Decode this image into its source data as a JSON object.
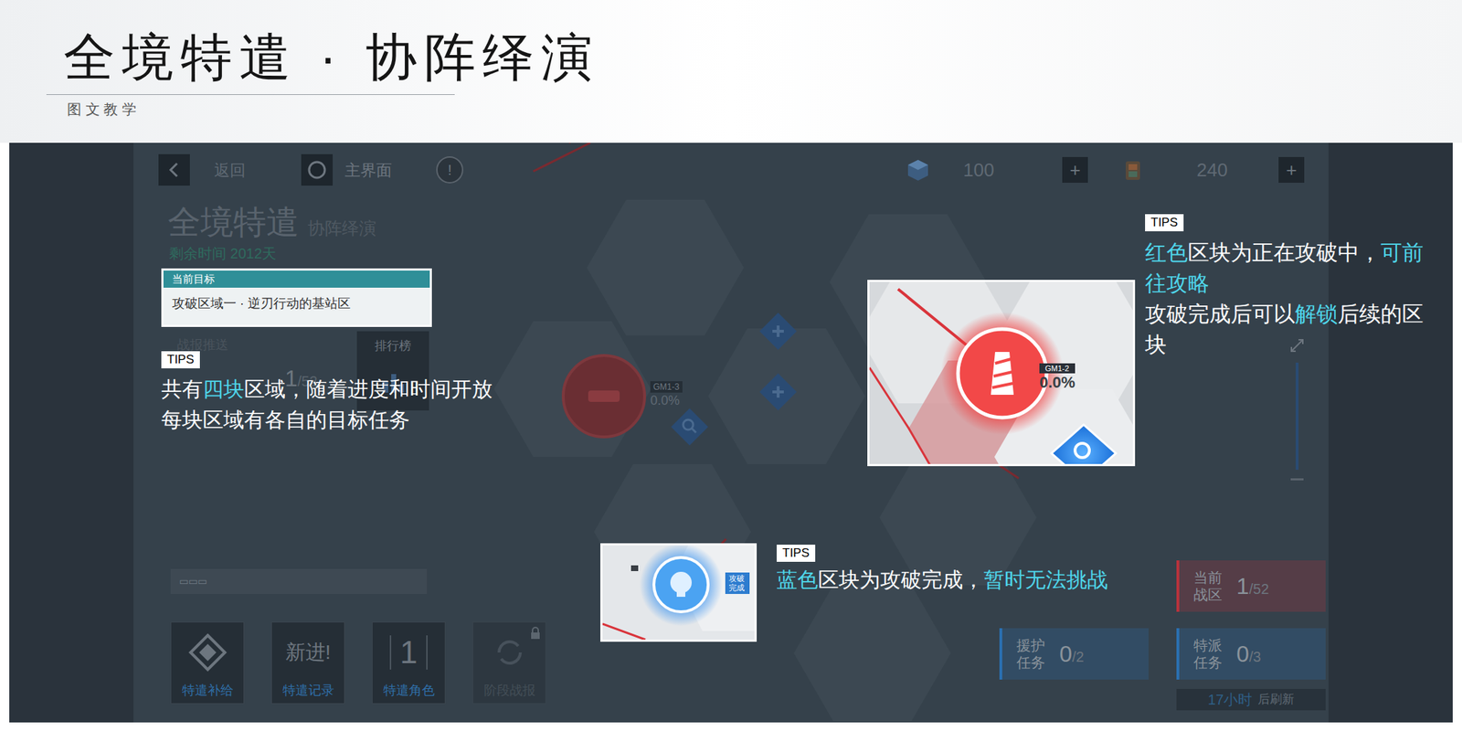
{
  "header": {
    "title": "全境特遣 · 协阵绎演",
    "subtitle": "图 文 教 学"
  },
  "game": {
    "top_bar": {
      "back": "返回",
      "home": "主界面",
      "alert": "!",
      "currencies": [
        {
          "value": "100",
          "plus": "+"
        },
        {
          "value": "240",
          "plus": "+"
        }
      ]
    },
    "title": "全境特遣",
    "subtitle": "协阵绎演",
    "time_left": "剩余时间 2012天",
    "target": {
      "header": "当前目标",
      "text": "攻破区域一 · 逆刃行动的基站区"
    },
    "news": "战报推送",
    "progress": {
      "value": "1",
      "total": "/52"
    },
    "ranking": "排行榜",
    "search_hint": "▭▭▭",
    "map_node": {
      "code": "GM1-3",
      "reading": "0.0%"
    },
    "bottom_buttons": [
      {
        "label": "特遣补给",
        "kind": "icon",
        "disabled": false
      },
      {
        "label": "特遣记录",
        "kind": "badge",
        "badge": "新进!",
        "disabled": false
      },
      {
        "label": "特遣角色",
        "kind": "count",
        "count": "1",
        "disabled": false
      },
      {
        "label": "阶段战报",
        "kind": "locked",
        "disabled": true
      }
    ],
    "panels": [
      {
        "label": "当前战区",
        "value": "1",
        "total": "/52",
        "color": "#b8323c"
      },
      {
        "label": "援护任务",
        "value": "0",
        "total": "/2",
        "color": "#2a6fb0"
      },
      {
        "label": "特派任务",
        "value": "0",
        "total": "/3",
        "color": "#2a6fb0"
      }
    ],
    "refresh": {
      "time": "17小时",
      "suffix": "后刷新"
    }
  },
  "tips": [
    {
      "label": "TIPS",
      "lines": [
        [
          {
            "text": "共有",
            "highlight": false
          },
          {
            "text": "四块",
            "highlight": true
          },
          {
            "text": "区域，随着进度和时间开放",
            "highlight": false
          }
        ],
        [
          {
            "text": "每块区域有各自的目标任务",
            "highlight": false
          }
        ]
      ]
    },
    {
      "label": "TIPS",
      "thumb": {
        "code": "GM1-2",
        "reading": "0.0%"
      },
      "lines": [
        [
          {
            "text": "红色",
            "highlight": true
          },
          {
            "text": "区块为正在攻破中，",
            "highlight": false
          },
          {
            "text": "可前往攻略",
            "highlight": true
          }
        ],
        [
          {
            "text": "攻破完成后可以",
            "highlight": false
          },
          {
            "text": "解锁",
            "highlight": true
          },
          {
            "text": "后续的区块",
            "highlight": false
          }
        ]
      ]
    },
    {
      "label": "TIPS",
      "thumb": {
        "status": "攻破完成"
      },
      "lines": [
        [
          {
            "text": "蓝色",
            "highlight": true
          },
          {
            "text": "区块为攻破完成，",
            "highlight": false
          },
          {
            "text": "暂时无法挑战",
            "highlight": true
          }
        ]
      ]
    }
  ]
}
